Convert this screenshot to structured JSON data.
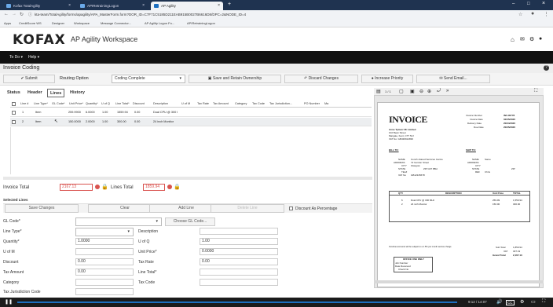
{
  "browser": {
    "tabs": [
      {
        "label": "Kofax TotalAgility",
        "color": "#6aa9e8"
      },
      {
        "label": "APIRetrainingLogon",
        "color": "#6aa9e8"
      },
      {
        "label": "AP Agility",
        "color": "#1c6fc0"
      }
    ],
    "new_tab": "+",
    "url": "kta-team/TotalAgility/forms/apagility/APA_MasterForm.form?DOR_ID=C7F71C5185D211EAB915B0027B6616D8/DPC=2&NODE_ID=4",
    "bookmarks": [
      "Apps",
      "CreditScore WS",
      "Designer",
      "Workspace",
      "Message Connector...",
      "AP Agility Logon Fo...",
      "APIRetrainingLogon"
    ]
  },
  "app": {
    "logo": "KOFAX",
    "workspace": "AP Agility Workspace",
    "menu": [
      "To Do",
      "Help"
    ]
  },
  "page": {
    "title": "Invoice Coding"
  },
  "toolbar": {
    "submit": "Submit",
    "routing_label": "Routing Option",
    "routing_value": "Coding Complete",
    "save_retain": "Save and Retain Ownership",
    "discard": "Discard Changes",
    "increase_priority": "Increase Priority",
    "send_email": "Send Email..."
  },
  "subtabs": [
    "Status",
    "Header",
    "Lines",
    "History"
  ],
  "grid": {
    "headers": [
      "Line #",
      "Line Type*",
      "GL Code*",
      "Unit Price*",
      "Quantity*",
      "U of Q",
      "Line Total*",
      "Discount",
      "Description",
      "U of M",
      "Tax Rate",
      "Tax Amount",
      "Category",
      "Tax Code",
      "Tax Jurisdiction...",
      "PO Number",
      "Ma"
    ],
    "rows": [
      {
        "line": "1",
        "type": "Item",
        "gl": "",
        "unit_price": "259.9900",
        "qty": "6.0000",
        "uoq": "1.00",
        "line_total": "1559.94",
        "discount": "0.00",
        "description": "Dual CPU @ 300 I"
      },
      {
        "line": "2",
        "type": "Item",
        "gl": "",
        "unit_price": "150.0000",
        "qty": "2.0000",
        "uoq": "1.00",
        "line_total": "300.00",
        "discount": "0.00",
        "description": "24 inch Monitor"
      }
    ]
  },
  "totals": {
    "invoice_label": "Invoice Total",
    "invoice_value": "2167.13",
    "lines_label": "Lines Total",
    "lines_value": "1859.94"
  },
  "selected_lines": {
    "heading": "Selected Lines",
    "save_changes": "Save Changes",
    "clear": "Clear",
    "add_line": "Add Line",
    "delete_line": "Delete Line",
    "discount_pct": "Discount As Percentage"
  },
  "form": {
    "gl_code_label": "GL Code*",
    "choose_gl": "Choose GL Code...",
    "line_type_label": "Line Type*",
    "description_label": "Description",
    "quantity_label": "Quantity*",
    "quantity_value": "1.0000",
    "uofq_label": "U of Q",
    "uofq_value": "1.00",
    "uofm_label": "U of M",
    "unit_price_label": "Unit Price*",
    "unit_price_value": "0.0000",
    "discount_label": "Discount",
    "discount_value": "0.00",
    "tax_rate_label": "Tax Rate",
    "tax_rate_value": "0.00",
    "tax_amount_label": "Tax Amount",
    "tax_amount_value": "0.00",
    "line_total_label": "Line Total*",
    "category_label": "Category",
    "tax_code_label": "Tax Code",
    "tax_jur_label": "Tax Jurisdiction Code"
  },
  "preview": {
    "page": "1 / 1",
    "invoice_title": "INVOICE",
    "meta": [
      {
        "k": "Invoice Number",
        "v": "INV-00778"
      },
      {
        "k": "Invoice Date",
        "v": "02/05/2020"
      },
      {
        "k": "Delivery Date",
        "v": "20/04/2020"
      },
      {
        "k": "Due Date",
        "v": "20/05/2020"
      }
    ],
    "seller": [
      "Anne Tyman UK Limited",
      "102 Bean Street",
      "Margate, Kent, CT7 5JJ",
      "VAT No: GB436912830"
    ],
    "bill_to": "BILL TO:",
    "ship_to": "SHIP TO:",
    "bill": [
      {
        "k": "NAME",
        "v": "Conch shared Services Centre"
      },
      {
        "k": "ADDRESS",
        "v": "72 Gordon Street"
      },
      {
        "k": "CITY",
        "v": "Glasgow"
      },
      {
        "k": "STATE",
        "v": "ZIP  G67 8BH"
      },
      {
        "k": "TEL#",
        "v": ""
      },
      {
        "k": "VAT No",
        "v": "GB12345678"
      }
    ],
    "ship": [
      {
        "k": "NAME",
        "v": "Same"
      },
      {
        "k": "ADDRESS",
        "v": ""
      },
      {
        "k": "CITY",
        "v": ""
      },
      {
        "k": "STATE",
        "v": "ZIP"
      },
      {
        "k": "REF",
        "v": "Chris"
      }
    ],
    "cols": [
      "QTY",
      "DESCRIPTION",
      "Unit Price",
      "TOTAL"
    ],
    "items": [
      {
        "qty": "6",
        "desc": "Dual CPU @ 300 MHz",
        "price": "259.99",
        "total": "1,559.94"
      },
      {
        "qty": "2",
        "desc": "24 inch Monitor",
        "price": "150.00",
        "total": "300.00"
      }
    ],
    "note": "Overdue accounts will be subject to a 1.5% per month service charge",
    "subtotal_label": "Sub Total",
    "subtotal": "1,859.94",
    "vat_label": "VAT",
    "vat": "307.19",
    "grand_label": "Grand Total",
    "grand": "2,167.13",
    "office": "OFFICE USE ONLY",
    "office_rows": [
      "Job Number",
      "Date Received",
      "Check No"
    ]
  },
  "taskbar": {
    "time": "9:12 / 14:07",
    "cc": "CC"
  },
  "colors": {
    "accent": "#1c6fc0",
    "error": "#d9534f",
    "menu": "#111111",
    "tabbar": "#1f3350"
  }
}
